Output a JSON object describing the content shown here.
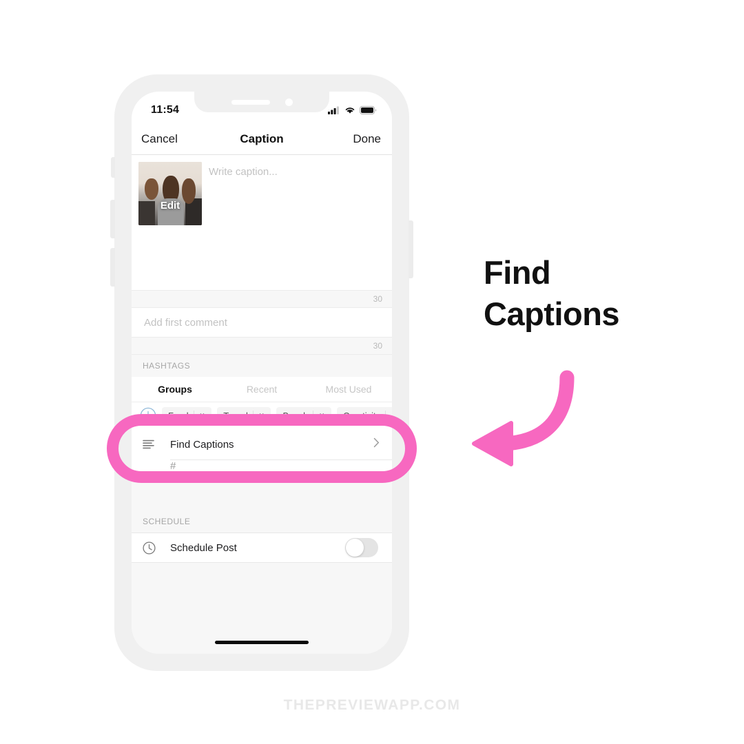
{
  "colors": {
    "accent_pink": "#f768c0",
    "heading_black": "#111111",
    "watermark_gray": "#e8e8e8",
    "add_button_blue": "#8fb8d8",
    "screen_bg": "#fafafa",
    "frame_gray": "#f0f0f0"
  },
  "status_bar": {
    "time": "11:54",
    "signal_icon": "cellular-signal-icon",
    "wifi_icon": "wifi-icon",
    "battery_icon": "battery-icon"
  },
  "nav_bar": {
    "cancel_label": "Cancel",
    "title": "Caption",
    "done_label": "Done"
  },
  "caption_section": {
    "thumbnail_alt": "post-photo-three-women",
    "edit_label": "Edit",
    "placeholder": "Write caption...",
    "char_counter": "30"
  },
  "comment_section": {
    "placeholder": "Add first comment",
    "char_counter": "30"
  },
  "hashtags_section": {
    "header": "HASHTAGS",
    "tabs": [
      {
        "label": "Groups",
        "active": true
      },
      {
        "label": "Recent",
        "active": false
      },
      {
        "label": "Most Used",
        "active": false
      }
    ],
    "add_button_icon": "plus-circle-icon",
    "chips": [
      {
        "label": "Food",
        "remove_icon": "close-icon"
      },
      {
        "label": "Travel",
        "remove_icon": "close-icon"
      },
      {
        "label": "Beach",
        "remove_icon": "close-icon"
      },
      {
        "label": "Creativity",
        "remove_icon": "close-icon"
      }
    ]
  },
  "find_captions_row": {
    "icon": "text-lines-icon",
    "label": "Find Captions",
    "chevron_icon": "chevron-right-icon",
    "partial_row_label": "#"
  },
  "schedule_section": {
    "header": "SCHEDULE",
    "icon": "clock-icon",
    "label": "Schedule Post",
    "toggle_state": "off"
  },
  "callout": {
    "line1": "Find",
    "line2": "Captions",
    "arrow_icon": "curved-arrow-left-icon"
  },
  "watermark": {
    "text": "THEPREVIEWAPP.COM"
  }
}
